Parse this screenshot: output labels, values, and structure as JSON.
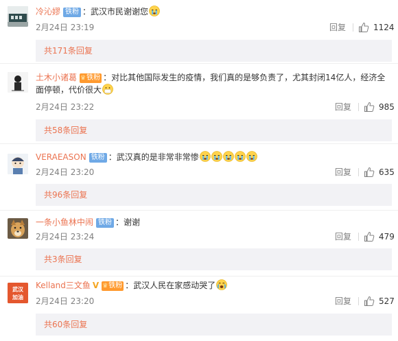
{
  "comments": [
    {
      "username": "冷沁嫪",
      "badge": "铁粉",
      "badge_type": "plain",
      "verified": false,
      "text": "：武汉市民谢谢您",
      "text_line2": "",
      "emojis": [
        "crying"
      ],
      "date": "2月24日 23:19",
      "reply_label": "回复",
      "likes": "1124",
      "more_replies": "共171条回复"
    },
    {
      "username": "土木小诸葛",
      "badge": "铁粉",
      "badge_type": "gold",
      "verified": false,
      "text": "：对比其他国际发生的疫情，我们真的是够负责了，尤其封闭14亿人，经济全",
      "text_line2": "面停顿，代价很大",
      "emojis": [
        "mask"
      ],
      "date": "2月24日 23:22",
      "reply_label": "回复",
      "likes": "985",
      "more_replies": "共58条回复"
    },
    {
      "username": "VERAEASON",
      "badge": "铁粉",
      "badge_type": "plain",
      "verified": false,
      "text": "：武汉真的是非常非常惨",
      "text_line2": "",
      "emojis": [
        "crying",
        "crying",
        "crying",
        "crying",
        "crying"
      ],
      "date": "2月24日 23:20",
      "reply_label": "回复",
      "likes": "635",
      "more_replies": "共96条回复"
    },
    {
      "username": "一条小鱼林中闹",
      "badge": "铁粉",
      "badge_type": "plain",
      "verified": false,
      "text": "：谢谢",
      "text_line2": "",
      "emojis": [],
      "date": "2月24日 23:24",
      "reply_label": "回复",
      "likes": "479",
      "more_replies": "共3条回复"
    },
    {
      "username": "Kelland三文鱼",
      "badge": "铁粉",
      "badge_type": "gold",
      "verified": true,
      "text": "：武汉人民在家感动哭了",
      "text_line2": "",
      "emojis": [
        "sob"
      ],
      "date": "2月24日 23:20",
      "reply_label": "回复",
      "likes": "527",
      "more_replies": "共60条回复"
    }
  ],
  "avatar_text_5": "武汉\n加油",
  "colors": {
    "username": "#eb7350",
    "more_bg": "#f2f2f5",
    "badge_blue": "#6fa9e6",
    "badge_gold": "#ff9a2f",
    "meta": "#808080"
  }
}
